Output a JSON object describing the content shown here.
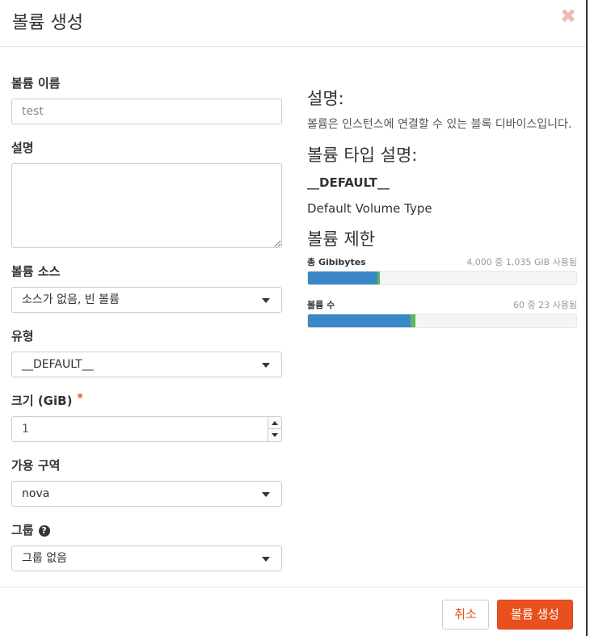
{
  "dialog": {
    "title": "볼륨 생성"
  },
  "form": {
    "name": {
      "label": "볼륨 이름",
      "placeholder": "test",
      "value": ""
    },
    "description": {
      "label": "설명"
    },
    "source": {
      "label": "볼륨 소스",
      "selected": "소스가 없음, 빈 볼륨"
    },
    "type": {
      "label": "유형",
      "selected": "__DEFAULT__"
    },
    "size": {
      "label": "크기 (GiB)",
      "required_mark": "*",
      "value": "1"
    },
    "availability_zone": {
      "label": "가용 구역",
      "selected": "nova"
    },
    "group": {
      "label": "그룹",
      "help_glyph": "?",
      "selected": "그룹 없음"
    }
  },
  "info": {
    "description_heading": "설명:",
    "description_text": "볼륨은 인스턴스에 연결할 수 있는 블록 디바이스입니다.",
    "type_heading": "볼륨 타입 설명:",
    "type_name": "__DEFAULT__",
    "type_description": "Default Volume Type",
    "limits_heading": "볼륨 제한",
    "limits": [
      {
        "name": "총 Gibibytes",
        "value_text": "4,000 중 1,035 GIB 사용됨",
        "used": 1035,
        "total": 4000,
        "new": 1,
        "color": "#3a87c8",
        "new_color": "#5cb85c"
      },
      {
        "name": "볼륨 수",
        "value_text": "60 중 23 사용됨",
        "used": 23,
        "total": 60,
        "new": 1,
        "color": "#3a87c8",
        "new_color": "#5cb85c"
      }
    ]
  },
  "footer": {
    "cancel_label": "취소",
    "submit_label": "볼륨 생성"
  },
  "colors": {
    "accent": "#e8501d",
    "progress": "#3a87c8",
    "progress_new": "#5cb85c"
  }
}
